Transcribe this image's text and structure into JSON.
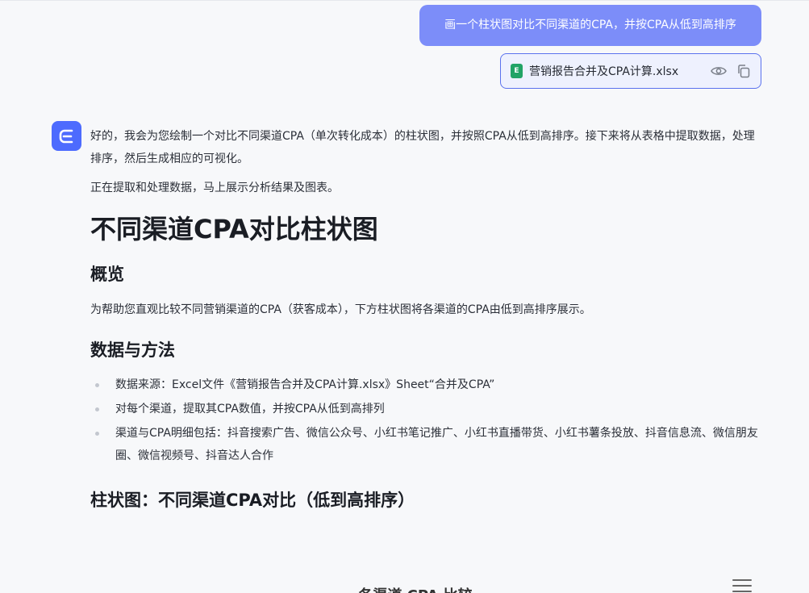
{
  "user_message": {
    "text": "画一个柱状图对比不同渠道的CPA，并按CPA从低到高排序"
  },
  "attachment": {
    "icon": "excel-file-icon",
    "icon_letter": "E",
    "file_name": "营销报告合并及CPA计算.xlsx",
    "actions": [
      "eye-icon",
      "copy-icon"
    ]
  },
  "assistant": {
    "avatar_icon": "assistant-logo-icon",
    "intro": "好的，我会为您绘制一个对比不同渠道CPA（单次转化成本）的柱状图，并按照CPA从低到高排序。接下来将从表格中提取数据，处理排序，然后生成相应的可视化。",
    "status": "正在提取和处理数据，马上展示分析结果及图表。",
    "report": {
      "title": "不同渠道CPA对比柱状图",
      "overview_heading": "概览",
      "overview_text": "为帮助您直观比较不同营销渠道的CPA（获客成本），下方柱状图将各渠道的CPA由低到高排序展示。",
      "method_heading": "数据与方法",
      "method_items": [
        "数据来源：Excel文件《营销报告合并及CPA计算.xlsx》Sheet“合并及CPA”",
        "对每个渠道，提取其CPA数值，并按CPA从低到高排列",
        "渠道与CPA明细包括：抖音搜索广告、微信公众号、小红书笔记推广、小红书直播带货、小红书薯条投放、抖音信息流、微信朋友圈、微信视频号、抖音达人合作"
      ],
      "chart_heading": "柱状图：不同渠道CPA对比（低到高排序）",
      "chart_title": "各渠道 CPA 比较",
      "chart_menu_icon": "hamburger-menu-icon"
    }
  },
  "colors": {
    "user_bubble": "#7c8df9",
    "avatar": "#4d6bfe",
    "file_card_border": "#5b72ee",
    "excel_green": "#21a366"
  }
}
